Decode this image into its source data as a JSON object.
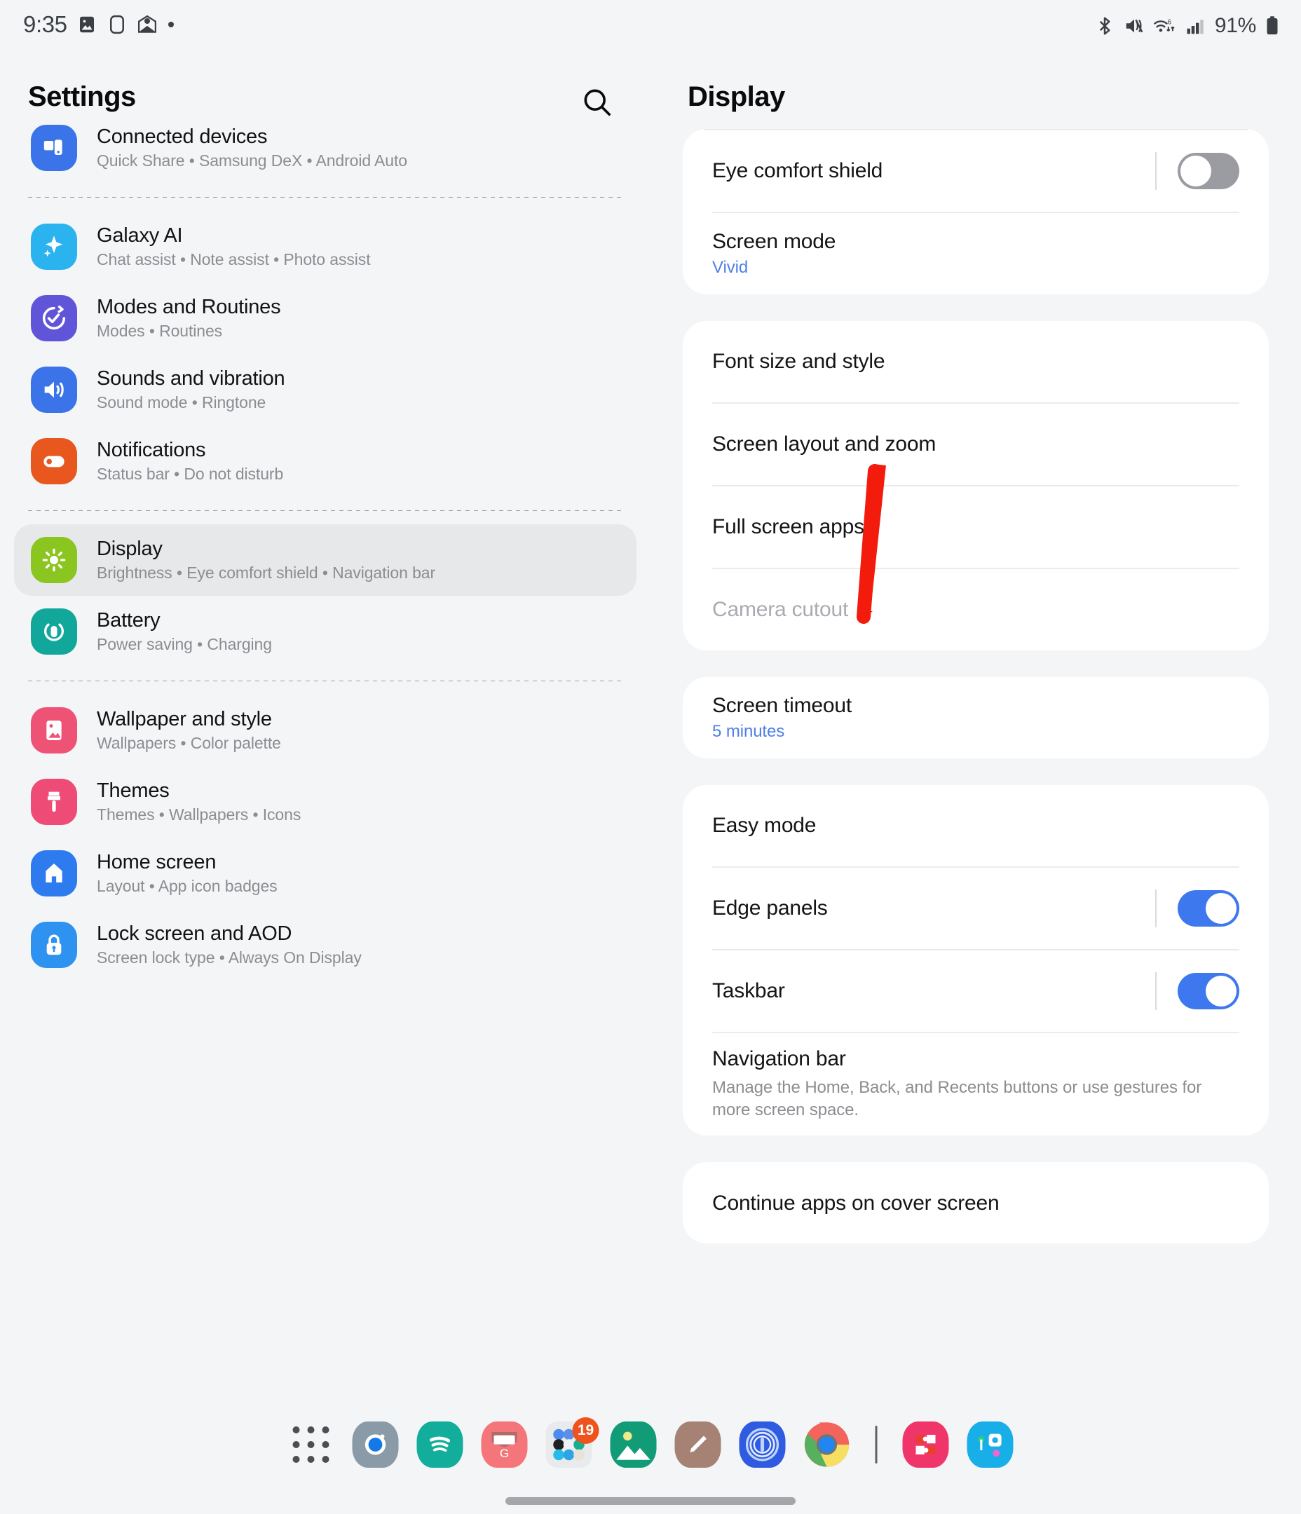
{
  "status_bar": {
    "time": "9:35",
    "battery_percent": "91%",
    "left_icons": [
      "image-icon",
      "tablet-icon",
      "mail-icon",
      "dot-icon"
    ],
    "right_icons": [
      "bluetooth-icon",
      "mute-vibrate-icon",
      "wifi6-icon",
      "signal-icon"
    ]
  },
  "sidebar": {
    "title": "Settings",
    "search_icon": "search-icon",
    "items": [
      {
        "label": "Connected devices",
        "sub": "Quick Share  •  Samsung DeX  •  Android Auto",
        "icon": "connected-devices-icon",
        "color": "#3B74E8",
        "selected": false,
        "clipped": true
      },
      {
        "label": "Galaxy AI",
        "sub": "Chat assist  •  Note assist  •  Photo assist",
        "icon": "galaxy-ai-icon",
        "color": "#2BB3F0",
        "selected": false
      },
      {
        "label": "Modes and Routines",
        "sub": "Modes  •  Routines",
        "icon": "modes-routines-icon",
        "color": "#6055D8",
        "selected": false
      },
      {
        "label": "Sounds and vibration",
        "sub": "Sound mode  •  Ringtone",
        "icon": "sound-icon",
        "color": "#3B74E8",
        "selected": false
      },
      {
        "label": "Notifications",
        "sub": "Status bar  •  Do not disturb",
        "icon": "notifications-icon",
        "color": "#E8571E",
        "selected": false
      },
      {
        "label": "Display",
        "sub": "Brightness  •  Eye comfort shield  •  Navigation bar",
        "icon": "display-icon",
        "color": "#8BC520",
        "selected": true
      },
      {
        "label": "Battery",
        "sub": "Power saving  •  Charging",
        "icon": "battery-icon",
        "color": "#12A79B",
        "selected": false
      },
      {
        "label": "Wallpaper and style",
        "sub": "Wallpapers  •  Color palette",
        "icon": "wallpaper-icon",
        "color": "#EE5275",
        "selected": false
      },
      {
        "label": "Themes",
        "sub": "Themes  •  Wallpapers  •  Icons",
        "icon": "themes-icon",
        "color": "#EE4B76",
        "selected": false
      },
      {
        "label": "Home screen",
        "sub": "Layout  •  App icon badges",
        "icon": "home-screen-icon",
        "color": "#2E7BF0",
        "selected": false
      },
      {
        "label": "Lock screen and AOD",
        "sub": "Screen lock type  •  Always On Display",
        "icon": "lock-screen-icon",
        "color": "#2E92F0",
        "selected": false
      }
    ],
    "separator_after": [
      0,
      4,
      6
    ]
  },
  "display_panel": {
    "title": "Display",
    "cards": [
      {
        "clipped_top": true,
        "rows": [
          {
            "label": "Eye comfort shield",
            "control": "toggle",
            "toggle_state": "off"
          },
          {
            "label": "Screen mode",
            "value": "Vivid"
          }
        ]
      },
      {
        "rows": [
          {
            "label": "Font size and style"
          },
          {
            "label": "Screen layout and zoom"
          },
          {
            "label": "Full screen apps"
          },
          {
            "label": "Camera cutout",
            "disabled": true
          }
        ]
      },
      {
        "rows": [
          {
            "label": "Screen timeout",
            "value": "5 minutes"
          }
        ]
      },
      {
        "rows": [
          {
            "label": "Easy mode"
          },
          {
            "label": "Edge panels",
            "control": "toggle",
            "toggle_state": "on"
          },
          {
            "label": "Taskbar",
            "control": "toggle",
            "toggle_state": "on"
          },
          {
            "label": "Navigation bar",
            "desc": "Manage the Home, Back, and Recents buttons or use gestures for more screen space."
          }
        ]
      },
      {
        "rows": [
          {
            "label": "Continue apps on cover screen"
          }
        ]
      }
    ]
  },
  "annotation": {
    "type": "arrow",
    "color": "#F21B0C",
    "points_to": "Full screen apps"
  },
  "dock": {
    "items": [
      {
        "name": "apps-grid-icon",
        "kind": "grid"
      },
      {
        "name": "camera-app-icon",
        "kind": "solid",
        "color": "#8A9AA6"
      },
      {
        "name": "spotify-icon",
        "kind": "solid",
        "color": "#13AE9B"
      },
      {
        "name": "gmail-icon",
        "kind": "solid",
        "color": "#F4757A"
      },
      {
        "name": "app-folder-icon",
        "kind": "folder",
        "color": "#E9EAEC",
        "badge": "19"
      },
      {
        "name": "gallery-icon",
        "kind": "solid",
        "color": "#119B76"
      },
      {
        "name": "notes-icon",
        "kind": "solid",
        "color": "#A68274"
      },
      {
        "name": "onepassword-icon",
        "kind": "solid",
        "color": "#2E5BE0"
      },
      {
        "name": "chrome-icon",
        "kind": "chrome"
      },
      {
        "name": "dock-separator",
        "kind": "separator"
      },
      {
        "name": "goodlock-icon",
        "kind": "solid",
        "color": "#F0356B"
      },
      {
        "name": "smartthings-icon",
        "kind": "solid",
        "color": "#18AEE8"
      }
    ]
  }
}
